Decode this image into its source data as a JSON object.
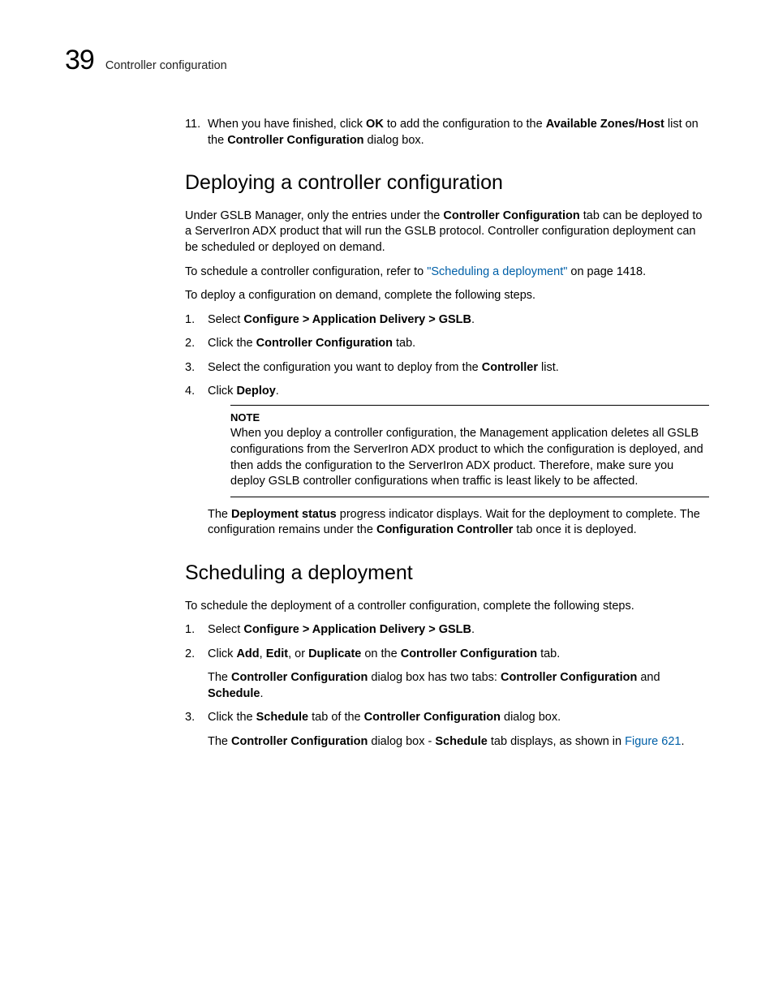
{
  "header": {
    "chapter_number": "39",
    "chapter_title": "Controller configuration"
  },
  "step11": {
    "pre": "When you have finished, click ",
    "ok": "OK",
    "mid": " to add the configuration to the ",
    "azh": "Available Zones/Host",
    "mid2": " list on the ",
    "cc": "Controller Configuration",
    "post": " dialog box."
  },
  "sec1": {
    "title": "Deploying a controller configuration",
    "p1a": "Under GSLB Manager, only the entries under the ",
    "p1b": "Controller Configuration",
    "p1c": " tab can be deployed to a ServerIron ADX product that will run the GSLB protocol. Controller configuration deployment can be scheduled or deployed on demand.",
    "p2a": "To schedule a controller configuration, refer to ",
    "p2link": "\"Scheduling a deployment\"",
    "p2b": " on page 1418.",
    "p3": "To deploy a configuration on demand, complete the following steps.",
    "s1a": "Select ",
    "s1b": "Configure > Application Delivery > GSLB",
    "s1c": ".",
    "s2a": "Click the ",
    "s2b": "Controller Configuration",
    "s2c": " tab.",
    "s3a": "Select the configuration you want to deploy from the ",
    "s3b": "Controller",
    "s3c": " list.",
    "s4a": "Click ",
    "s4b": "Deploy",
    "s4c": ".",
    "note_title": "NOTE",
    "note_body": "When you deploy a controller configuration, the Management application deletes all GSLB configurations from the ServerIron ADX product to which the configuration is deployed, and then adds the configuration to the ServerIron ADX product. Therefore, make sure you deploy GSLB controller configurations when traffic is least likely to be affected.",
    "after_a": "The ",
    "after_b": "Deployment status",
    "after_c": " progress indicator displays. Wait for the deployment to complete. The configuration remains under the ",
    "after_d": "Configuration Controller",
    "after_e": " tab once it is deployed."
  },
  "sec2": {
    "title": "Scheduling a deployment",
    "p1": "To schedule the deployment of a controller configuration, complete the following steps.",
    "s1a": "Select ",
    "s1b": "Configure > Application Delivery > GSLB",
    "s1c": ".",
    "s2a": "Click ",
    "s2b": "Add",
    "s2c": ", ",
    "s2d": "Edit",
    "s2e": ", or ",
    "s2f": "Duplicate",
    "s2g": " on the ",
    "s2h": "Controller Configuration",
    "s2i": " tab.",
    "s2sub_a": "The ",
    "s2sub_b": "Controller Configuration",
    "s2sub_c": " dialog box has two tabs: ",
    "s2sub_d": "Controller Configuration",
    "s2sub_e": " and ",
    "s2sub_f": "Schedule",
    "s2sub_g": ".",
    "s3a": "Click the ",
    "s3b": "Schedule",
    "s3c": " tab of the ",
    "s3d": "Controller Configuration",
    "s3e": " dialog box.",
    "s3sub_a": "The ",
    "s3sub_b": "Controller Configuration",
    "s3sub_c": " dialog box - ",
    "s3sub_d": "Schedule",
    "s3sub_e": " tab displays, as shown in ",
    "s3sub_link": "Figure 621",
    "s3sub_f": "."
  }
}
